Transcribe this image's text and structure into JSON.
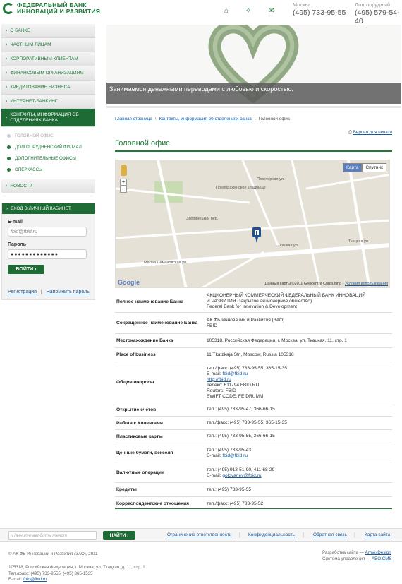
{
  "header": {
    "logo_line1": "ФЕДЕРАЛЬНЫЙ БАНК",
    "logo_line2": "ИННОВАЦИЙ И РАЗВИТИЯ",
    "icons": [
      "home-icon",
      "sitemap-icon",
      "mail-icon"
    ],
    "phones": [
      {
        "city": "Москва",
        "number": "(495) 733-95-55"
      },
      {
        "city": "Долгопрудный",
        "number": "(495) 579-54-40"
      }
    ]
  },
  "nav": {
    "items": [
      {
        "label": "О БАНКЕ"
      },
      {
        "label": "ЧАСТНЫМ ЛИЦАМ"
      },
      {
        "label": "КОРПОРАТИВНЫМ КЛИЕНТАМ"
      },
      {
        "label": "ФИНАНСОВЫМ ОРГАНИЗАЦИЯМ"
      },
      {
        "label": "КРЕДИТОВАНИЕ БИЗНЕСА"
      },
      {
        "label": "ИНТЕРНЕТ-БАНКИНГ"
      },
      {
        "label": "КОНТАКТЫ, ИНФОРМАЦИЯ ОБ ОТДЕЛЕНИЯХ БАНКА"
      }
    ],
    "subitems": [
      {
        "label": "ГОЛОВНОЙ ОФИС"
      },
      {
        "label": "ДОЛГОПРУДНЕНСКИЙ ФИЛИАЛ"
      },
      {
        "label": "ДОПОЛНИТЕЛЬНЫЕ ОФИСЫ"
      },
      {
        "label": "ОПЕРКАССЫ"
      }
    ],
    "news": "НОВОСТИ"
  },
  "login": {
    "title": "ВХОД В ЛИЧНЫЙ КАБИНЕТ",
    "email_label": "E-mail",
    "email_value": "fbid@fbid.ru",
    "password_label": "Пароль",
    "password_value": "●●●●●●●●●●●●●",
    "button": "ВОЙТИ",
    "register": "Регистрация",
    "remind": "Напомнить пароль"
  },
  "banner": {
    "caption": "Занимаемся денежными переводами с любовью и скоростью."
  },
  "content": {
    "breadcrumb": [
      "Главная страница",
      "Контакты, информация об отделениях банка",
      "Головной офис"
    ],
    "print_version": "Версия для печати",
    "title": "Головной офис",
    "map": {
      "type_map": "Карта",
      "type_sat": "Спутник",
      "attribution": "Данные карты ©2011 Geocentre Consulting - ",
      "terms": "Условия использования",
      "google": "Google",
      "labels": [
        "Преображенское кладбище",
        "Ткацкая ул.",
        "Ткацкая ул.",
        "Малая Семёновская ул.",
        "Зверинецкий пер.",
        "Просторная ул."
      ]
    },
    "rows": [
      {
        "k": "Полное наименование Банка",
        "v": [
          "АКЦИОНЕРНЫЙ КОММЕРЧЕСКИЙ ФЕДЕРАЛЬНЫЙ БАНК ИННОВАЦИЙ",
          "И РАЗВИТИЯ (закрытое акционерное общество)",
          "Federal Bank for Innovation & Development"
        ]
      },
      {
        "k": "Сокращенное наименование Банка",
        "v": [
          "АК ФБ Инноваций и Развития (ЗАО)",
          "FBID"
        ]
      },
      {
        "k": "Местонахождение Банка",
        "v": [
          "105318, Российская Федерация, г. Москва, ул. Ткацкая, 11, стр. 1"
        ]
      },
      {
        "k": "Place of business",
        "v": [
          "11 Tkatzkaja Str., Moscow, Russia 105318"
        ]
      },
      {
        "k": "Общие вопросы",
        "v": [
          "тел./факс: (495) 733-95-55, 365-15-35",
          "E-mail: ",
          "http://fbid.ru",
          "Телекс: 611794 FBID RU",
          "Reuters: FBID",
          "SWIFT CODE: FEIDRUMM"
        ],
        "email": "fbid@fbid.ru"
      },
      {
        "k": "Открытие счетов",
        "v": [
          "тел.: (495) 733-95-47, 366-66-15"
        ]
      },
      {
        "k": "Работа с Клиентами",
        "v": [
          "тел./факс: (495) 733-95-55, 365-15-35"
        ]
      },
      {
        "k": "Пластиковые карты",
        "v": [
          "тел.: (495) 733-95-55, 366-66-15"
        ]
      },
      {
        "k": "Ценные бумаги, векселя",
        "v": [
          "тел.: (495) 733-95-43",
          "E-mail: "
        ],
        "email": "fbid@fbid.ru"
      },
      {
        "k": "Валютные операции",
        "v": [
          "тел.: (495) 913-51-90, 411-68-29",
          "E-mail: "
        ],
        "email": "golovanev@fbid.ru"
      },
      {
        "k": "Кредиты",
        "v": [
          "тел.: (495) 733-95-55"
        ]
      },
      {
        "k": "Корреспондентские отношения",
        "v": [
          "тел./факс: (495) 733-95-52"
        ]
      }
    ]
  },
  "footer": {
    "search_placeholder": "Начните вводить текст",
    "search_button": "НАЙТИ",
    "links": [
      "Ограничение ответственности",
      "Конфиденциальность",
      "Обратная связь",
      "Карта сайта"
    ],
    "copyright": "© АК ФБ Инноваций и Развития (ЗАО), 2011",
    "address": "105318, Российская Федерация, г. Москва, ул. Ткацкая, д. 11, стр. 1",
    "phone": "Тел./факс: (495) 733-9555, (495) 365-1535",
    "email_label": "E-mail: ",
    "email": "fbid@fbid.ru",
    "dev_label": "Разработка сайта — ",
    "dev": "ArmexDesign",
    "cms_label": "Система управления — ",
    "cms": "ABO.CMS"
  },
  "colors": {
    "brand": "#1e6b36",
    "link": "#1a5a9a"
  }
}
